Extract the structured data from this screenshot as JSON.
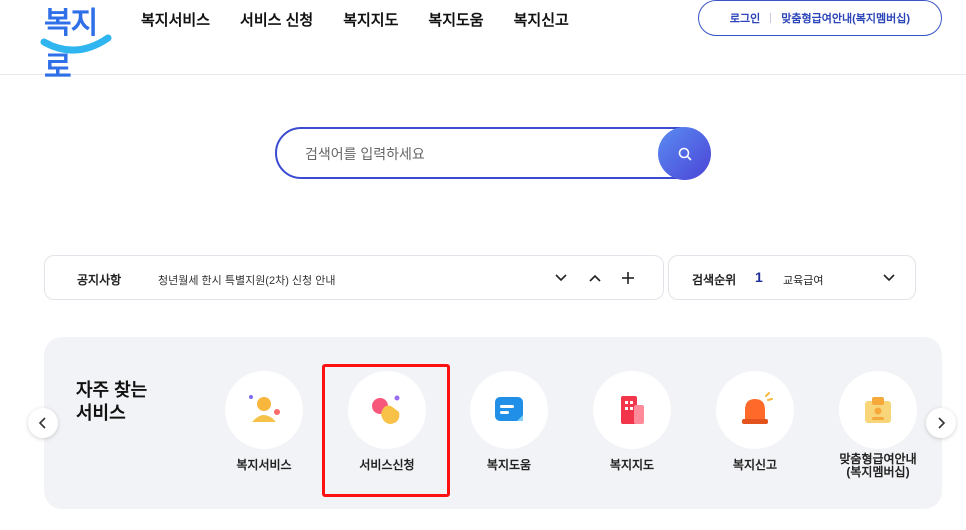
{
  "header": {
    "logo_text": "복지로",
    "nav": [
      "복지서비스",
      "서비스 신청",
      "복지지도",
      "복지도움",
      "복지신고"
    ],
    "login_label": "로그인",
    "membership_label": "맞춤형급여안내(복지멤버십)"
  },
  "search": {
    "placeholder": "검색어를 입력하세요",
    "button_icon": "search-icon"
  },
  "notice": {
    "label": "공지사항",
    "text": "청년월세 한시 특별지원(2차) 신청 안내",
    "controls": [
      "chevron-down-icon",
      "chevron-up-icon",
      "plus-icon"
    ]
  },
  "rank": {
    "label": "검색순위",
    "number": "1",
    "keyword": "교육급여"
  },
  "quick": {
    "title": "자주 찾는 서비스",
    "services": [
      {
        "label": "복지서비스",
        "icon": "person-icon"
      },
      {
        "label": "서비스신청",
        "icon": "tap-hand-icon"
      },
      {
        "label": "복지도움",
        "icon": "message-icon"
      },
      {
        "label": "복지지도",
        "icon": "building-icon"
      },
      {
        "label": "복지신고",
        "icon": "siren-icon"
      },
      {
        "label": "맞춤형급여안내\n(복지멤버십)",
        "icon": "membership-card-icon"
      }
    ]
  },
  "colors": {
    "brand": "#2f6fe8",
    "accent": "#3b4bd1",
    "highlight": "#ff1010"
  }
}
